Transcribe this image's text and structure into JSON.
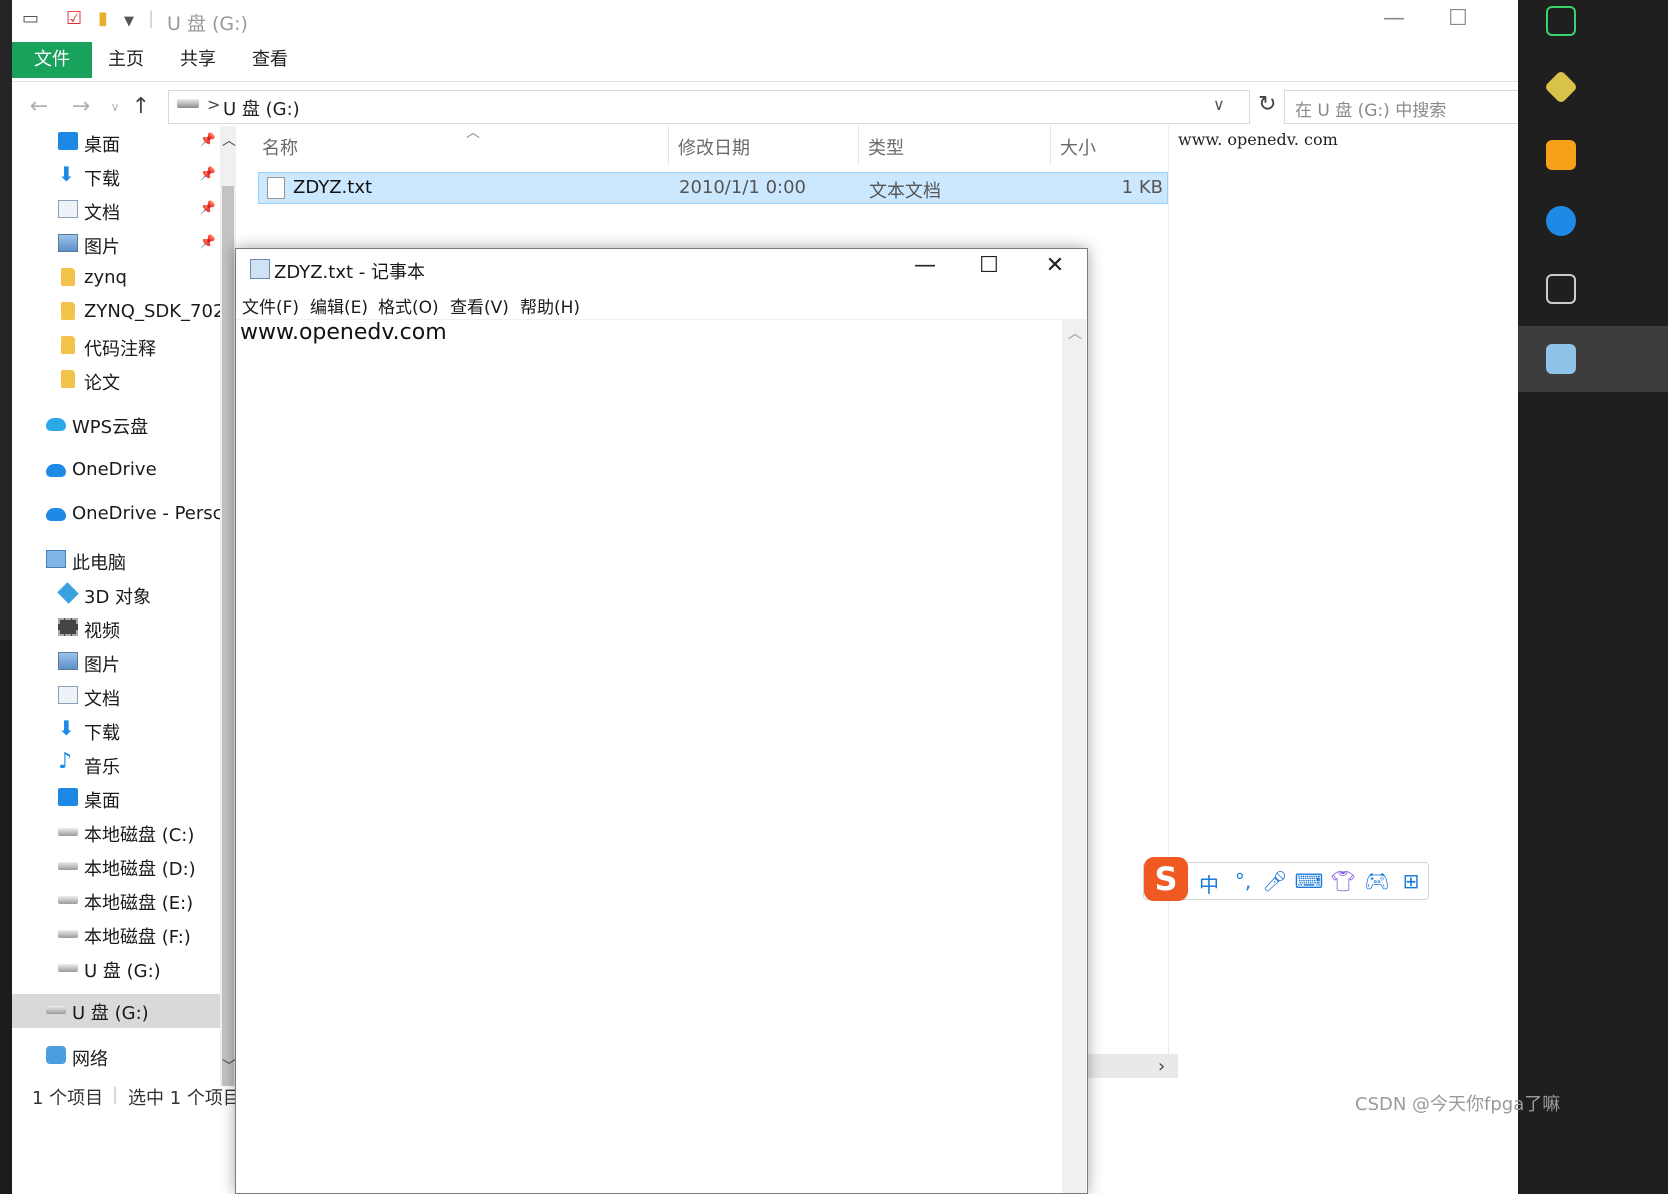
{
  "explorer": {
    "title": "U 盘 (G:)",
    "ribbon_tabs": [
      "文件",
      "主页",
      "共享",
      "查看"
    ],
    "address": {
      "path": "U 盘 (G:)",
      "separator": ">"
    },
    "search_placeholder": "在 U 盘 (G:) 中搜索",
    "nav_items": [
      {
        "label": "桌面",
        "icon": "desktop-icon",
        "pinned": true
      },
      {
        "label": "下载",
        "icon": "download-icon",
        "pinned": true
      },
      {
        "label": "文档",
        "icon": "document-icon",
        "pinned": true
      },
      {
        "label": "图片",
        "icon": "pictures-icon",
        "pinned": true
      },
      {
        "label": "zynq",
        "icon": "folder-icon"
      },
      {
        "label": "ZYNQ_SDK_702",
        "icon": "folder-icon"
      },
      {
        "label": "代码注释",
        "icon": "folder-icon"
      },
      {
        "label": "论文",
        "icon": "folder-icon"
      },
      {
        "label": "WPS云盘",
        "icon": "wps-cloud-icon"
      },
      {
        "label": "OneDrive",
        "icon": "onedrive-icon"
      },
      {
        "label": "OneDrive - Persc",
        "icon": "onedrive-icon"
      },
      {
        "label": "此电脑",
        "icon": "this-pc-icon"
      },
      {
        "label": "3D 对象",
        "icon": "3d-objects-icon"
      },
      {
        "label": "视频",
        "icon": "videos-icon"
      },
      {
        "label": "图片",
        "icon": "pictures-icon"
      },
      {
        "label": "文档",
        "icon": "document-icon"
      },
      {
        "label": "下载",
        "icon": "download-icon"
      },
      {
        "label": "音乐",
        "icon": "music-icon"
      },
      {
        "label": "桌面",
        "icon": "desktop-icon"
      },
      {
        "label": "本地磁盘 (C:)",
        "icon": "drive-icon"
      },
      {
        "label": "本地磁盘 (D:)",
        "icon": "drive-icon"
      },
      {
        "label": "本地磁盘 (E:)",
        "icon": "drive-icon"
      },
      {
        "label": "本地磁盘 (F:)",
        "icon": "drive-icon"
      },
      {
        "label": "U 盘 (G:)",
        "icon": "usb-drive-icon"
      },
      {
        "label": "U 盘 (G:)",
        "icon": "usb-drive-icon",
        "selected": true
      },
      {
        "label": "网络",
        "icon": "network-icon"
      }
    ],
    "columns": [
      "名称",
      "修改日期",
      "类型",
      "大小"
    ],
    "files": [
      {
        "name": "ZDYZ.txt",
        "modified": "2010/1/1 0:00",
        "type": "文本文档",
        "size": "1 KB",
        "selected": true
      }
    ],
    "preview_text": "www. openedv. com",
    "status": {
      "count": "1 个项目",
      "selection": "选中 1 个项目"
    }
  },
  "notepad": {
    "title": "ZDYZ.txt - 记事本",
    "menu": [
      "文件(F)",
      "编辑(E)",
      "格式(O)",
      "查看(V)",
      "帮助(H)"
    ],
    "content": "www.openedv.com"
  },
  "ime": {
    "logo": "S",
    "mode": "中",
    "punct": "°,",
    "icons": [
      "microphone-icon",
      "keyboard-icon",
      "skin-icon",
      "game-icon",
      "toolbox-icon"
    ]
  },
  "watermark": "CSDN @今天你fpga了嘛",
  "colors": {
    "accent_green": "#19a25a",
    "selection": "#cce8ff",
    "sogou_orange": "#f05a22"
  }
}
